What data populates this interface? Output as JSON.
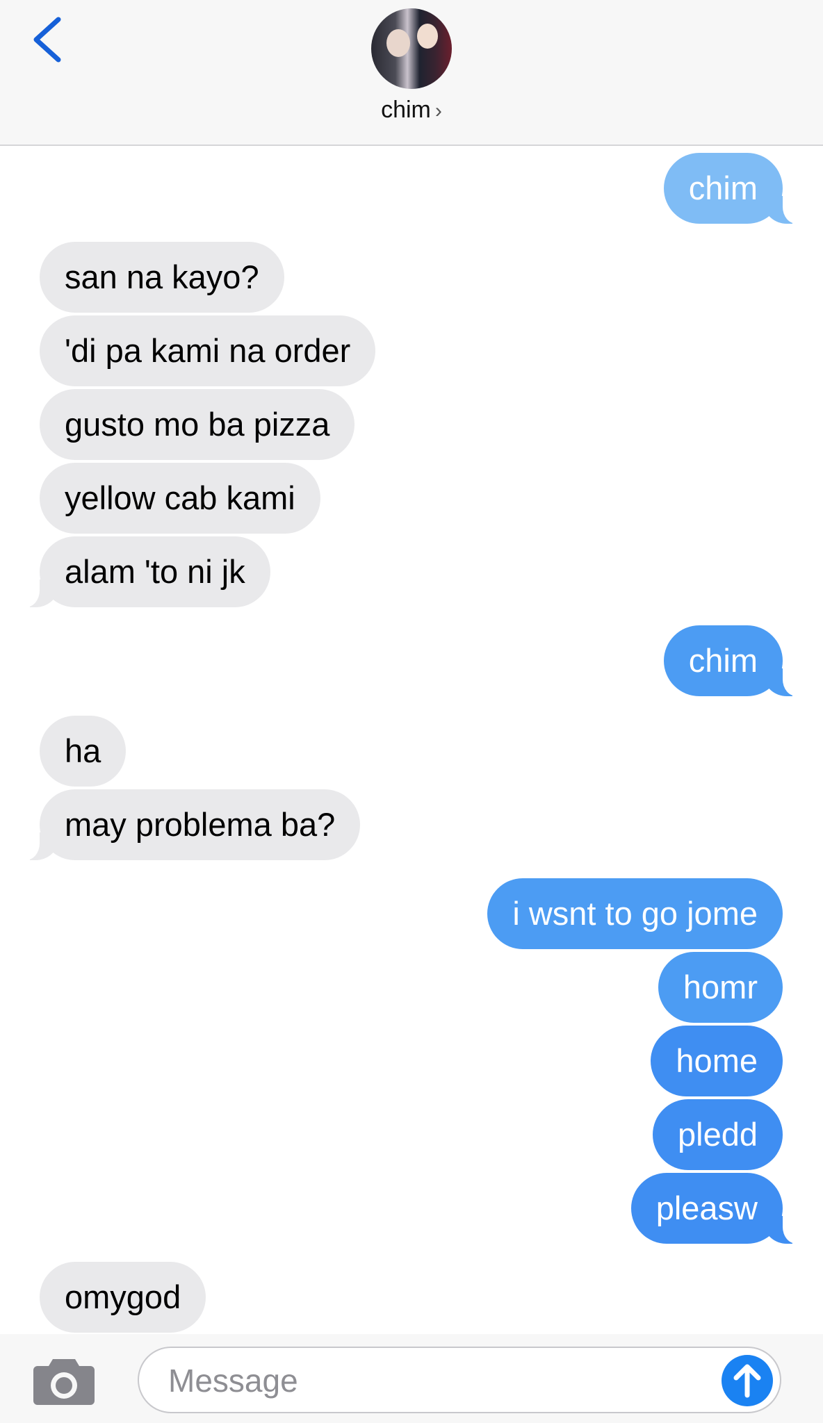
{
  "header": {
    "contact_name": "chim",
    "chevron": "›",
    "back_icon": "chevron-left-icon",
    "avatar": "contact-avatar-photo"
  },
  "colors": {
    "incoming_bubble": "#e9e9eb",
    "outgoing_bubble": "#3f8ef2",
    "accent": "#1a82f2"
  },
  "messages": [
    {
      "direction": "outgoing",
      "text": "chim"
    },
    {
      "direction": "incoming",
      "text": "san na kayo?"
    },
    {
      "direction": "incoming",
      "text": "'di pa kami na order"
    },
    {
      "direction": "incoming",
      "text": "gusto mo ba pizza"
    },
    {
      "direction": "incoming",
      "text": "yellow cab kami"
    },
    {
      "direction": "incoming",
      "text": "alam 'to ni jk"
    },
    {
      "direction": "outgoing",
      "text": "chim"
    },
    {
      "direction": "incoming",
      "text": "ha"
    },
    {
      "direction": "incoming",
      "text": "may problema ba?"
    },
    {
      "direction": "outgoing",
      "text": "i wsnt to go jome"
    },
    {
      "direction": "outgoing",
      "text": "homr"
    },
    {
      "direction": "outgoing",
      "text": "home"
    },
    {
      "direction": "outgoing",
      "text": "pledd"
    },
    {
      "direction": "outgoing",
      "text": "pleasw"
    },
    {
      "direction": "incoming",
      "text": "omygod"
    }
  ],
  "composer": {
    "placeholder": "Message",
    "value": "",
    "camera_icon": "camera-icon",
    "send_icon": "arrow-up-icon"
  }
}
